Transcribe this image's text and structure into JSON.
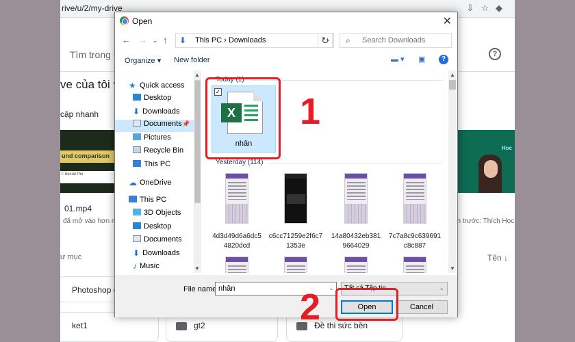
{
  "browser": {
    "url_fragment": "rive/u/2/my-drive"
  },
  "drive_bg": {
    "search_placeholder": "Tìm trong D",
    "my_drive_title": "ve của tôi ▾",
    "quick_access": "cập nhanh",
    "thumb_left_text": "und comparison",
    "thumb_left_words": "t:     besun    the",
    "thumb_right_brand": "Hoc",
    "file1_name": "01.mp4",
    "file1_meta": "đã mở vào hơn mộ",
    "file2_meta": "nh trước: Thích Học",
    "folders_label": "ư mục",
    "sort_label": "Tên  ↓",
    "folders": [
      "Photoshop c",
      "ket1",
      "gt2",
      "Đề thi sức bền"
    ]
  },
  "dialog": {
    "title": "Open",
    "address_path": "This PC  ›  Downloads",
    "search_placeholder": "Search Downloads",
    "organize_label": "Organize ▾",
    "new_folder_label": "New folder",
    "nav_items": [
      {
        "label": "Quick access"
      },
      {
        "label": "Desktop"
      },
      {
        "label": "Downloads"
      },
      {
        "label": "Documents"
      },
      {
        "label": "Pictures"
      },
      {
        "label": "Recycle Bin"
      },
      {
        "label": "This PC"
      },
      {
        "label": "OneDrive"
      },
      {
        "label": "This PC"
      },
      {
        "label": "3D Objects"
      },
      {
        "label": "Desktop"
      },
      {
        "label": "Documents"
      },
      {
        "label": "Downloads"
      },
      {
        "label": "Music"
      }
    ],
    "group_today": "Today (1)",
    "group_yesterday": "Yesterday (114)",
    "selected_file": "nhân",
    "files": [
      {
        "line1": "4d3d49d6a6dc5",
        "line2": "4820dcd"
      },
      {
        "line1": "c6cc71259e2f6c7",
        "line2": "1353e"
      },
      {
        "line1": "14a80432eb381",
        "line2": "9664029"
      },
      {
        "line1": "7c7a8c9c639691",
        "line2": "c8c887"
      }
    ],
    "filename_label": "File name:",
    "filename_value": "nhân",
    "filetype_value": "Tất cả Tệp tin",
    "open_button": "Open",
    "cancel_button": "Cancel"
  },
  "annotations": {
    "step1": "1",
    "step2": "2",
    "color": "#e31e24"
  }
}
